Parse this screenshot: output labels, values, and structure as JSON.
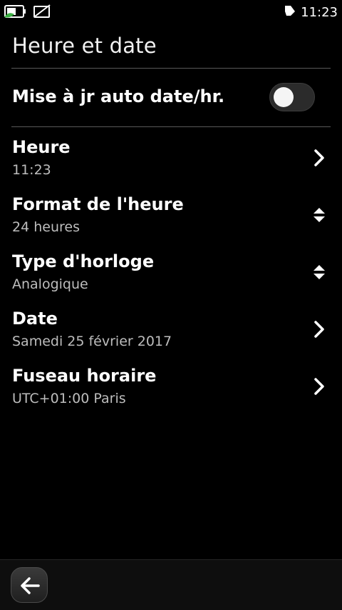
{
  "status_bar": {
    "time": "11:23",
    "left_icons": [
      "battery-charging-icon",
      "no-sim-icon"
    ],
    "right_icons": [
      "notification-flag-icon"
    ]
  },
  "page": {
    "title": "Heure et date"
  },
  "auto_update": {
    "label": "Mise à jr auto date/hr.",
    "enabled": false
  },
  "settings": [
    {
      "title": "Heure",
      "value": "11:23",
      "control": "chevron-right-icon"
    },
    {
      "title": "Format de l'heure",
      "value": "24 heures",
      "control": "up-down-selector-icon"
    },
    {
      "title": "Type d'horloge",
      "value": "Analogique",
      "control": "up-down-selector-icon"
    },
    {
      "title": "Date",
      "value": "Samedi 25 février 2017",
      "control": "chevron-right-icon"
    },
    {
      "title": "Fuseau horaire",
      "value": "UTC+01:00 Paris",
      "control": "chevron-right-icon"
    }
  ],
  "toolbar": {
    "back_icon": "back-arrow-icon"
  },
  "colors": {
    "background": "#000000",
    "text": "#ffffff",
    "secondary_text": "#bdbdbd",
    "divider": "#5a5a5a",
    "battery_accent": "#3cb043"
  }
}
